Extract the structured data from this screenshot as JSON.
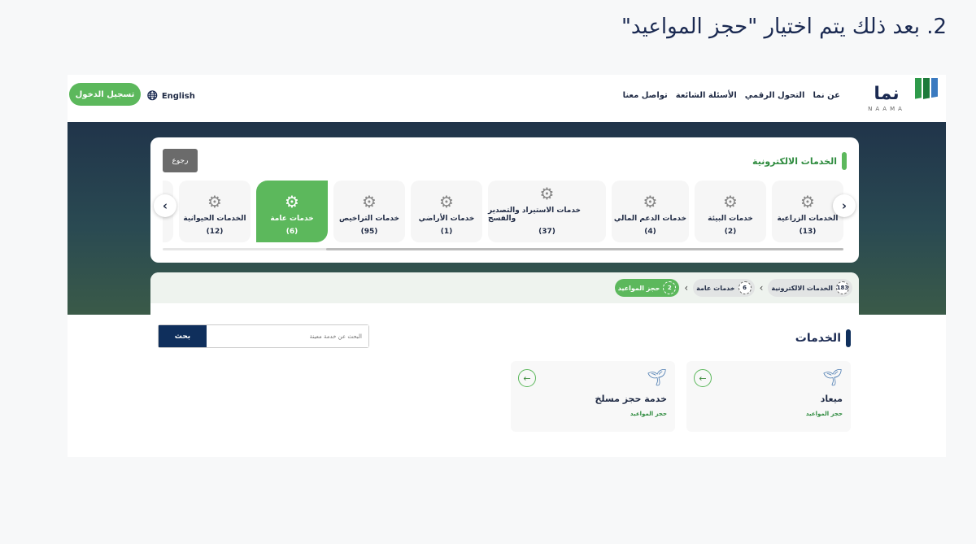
{
  "heading": "2.  بعد ذلك يتم اختيار \"حجز المواعيد\"",
  "header": {
    "logo_text": "نما",
    "logo_sub": "NAAMA",
    "nav": [
      "عن نما",
      "التحول الرقمي",
      "الأسئلة الشائعة",
      "تواصل معنا"
    ],
    "language": "English",
    "login": "تسجيل الدخول"
  },
  "eservices": {
    "title": "الخدمات الالكترونية",
    "back": "رجوع",
    "tiles": [
      {
        "label": "الخدمات الزراعية",
        "count": "(13)"
      },
      {
        "label": "خدمات البيئة",
        "count": "(2)"
      },
      {
        "label": "خدمات الدعم المالي",
        "count": "(4)"
      },
      {
        "label": "خدمات الاستيراد والتصدير والفسح",
        "count": "(37)"
      },
      {
        "label": "خدمات الأراضي",
        "count": "(1)"
      },
      {
        "label": "خدمات التراخيص",
        "count": "(95)"
      },
      {
        "label": "خدمات عامة",
        "count": "(6)",
        "active": true
      },
      {
        "label": "الخدمات الحيوانية",
        "count": "(12)"
      }
    ]
  },
  "breadcrumb": [
    {
      "num": "183",
      "label": "الخدمات الالكترونية"
    },
    {
      "num": "6",
      "label": "خدمات عامة"
    },
    {
      "num": "2",
      "label": "حجز المواعيد",
      "active": true
    }
  ],
  "services": {
    "title": "الخدمات",
    "search_placeholder": "البحث عن خدمة معينة",
    "search_button": "بحث",
    "cards": [
      {
        "title": "ميعاد",
        "category": "حجز المواعيد"
      },
      {
        "title": "خدمة حجز مسلخ",
        "category": "حجز المواعيد"
      }
    ]
  },
  "colors": {
    "accent": "#5cb85c",
    "navy": "#0f2f5c"
  }
}
